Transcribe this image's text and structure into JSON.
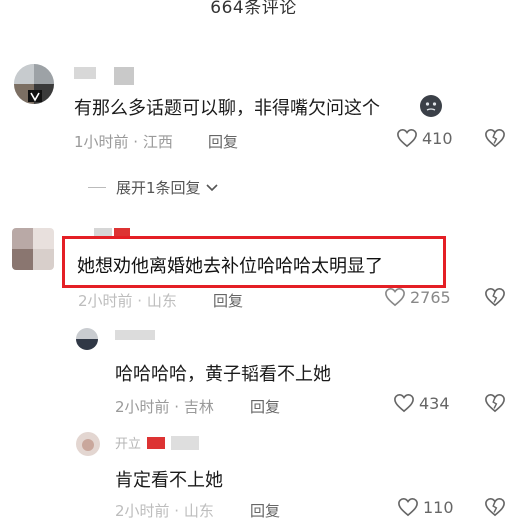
{
  "header": {
    "title": "664条评论"
  },
  "comments": [
    {
      "text": "有那么多话题可以聊，非得嘴欠问这个",
      "emoji": "dark-face-emoji",
      "meta": "1小时前 · 江西",
      "reply": "回复",
      "likes": "410"
    },
    {
      "text": "她想劝他离婚她去补位哈哈哈太明显了",
      "meta": "2小时前 · 山东",
      "reply": "回复",
      "likes": "2765"
    }
  ],
  "expand": {
    "label": "展开1条回复"
  },
  "replies": [
    {
      "text": "哈哈哈哈，黄子韬看不上她",
      "meta": "2小时前 · 吉林",
      "reply": "回复",
      "likes": "434"
    },
    {
      "name_partial": "开立",
      "text": "肯定看不上她",
      "meta": "2小时前 · 山东",
      "reply": "回复",
      "likes": "110"
    }
  ],
  "colors": {
    "highlight": "#e41f25",
    "meta": "#9a9a9a"
  }
}
